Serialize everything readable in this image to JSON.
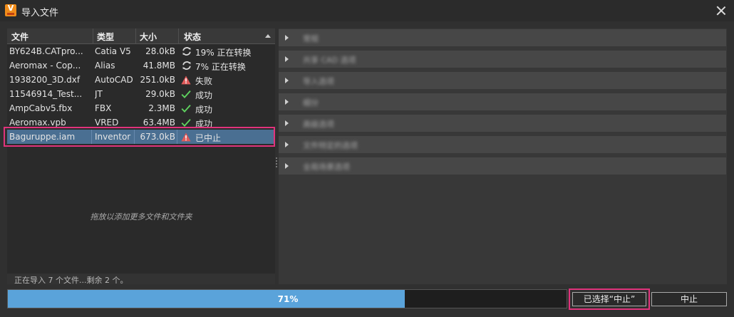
{
  "window": {
    "title": "导入文件"
  },
  "table": {
    "columns": {
      "file": "文件",
      "type": "类型",
      "size": "大小",
      "status": "状态"
    },
    "rows": [
      {
        "file": "BY624B.CATpro...",
        "type": "Catia V5",
        "size": "28.0kB",
        "status_icon": "refresh-icon",
        "status": "19% 正在转换"
      },
      {
        "file": "Aeromax - Cop...",
        "type": "Alias",
        "size": "41.8MB",
        "status_icon": "refresh-icon",
        "status": "7% 正在转换"
      },
      {
        "file": "1938200_3D.dxf",
        "type": "AutoCAD",
        "size": "251.0kB",
        "status_icon": "warning-icon",
        "status": "失败"
      },
      {
        "file": "11546914_Test...",
        "type": "JT",
        "size": "29.0kB",
        "status_icon": "check-icon",
        "status": "成功"
      },
      {
        "file": "AmpCabv5.fbx",
        "type": "FBX",
        "size": "2.3MB",
        "status_icon": "check-icon",
        "status": "成功"
      },
      {
        "file": "Aeromax.vpb",
        "type": "VRED",
        "size": "63.4MB",
        "status_icon": "check-icon",
        "status": "成功"
      },
      {
        "file": "Baguruppe.iam",
        "type": "Inventor",
        "size": "673.0kB",
        "status_icon": "warning-icon",
        "status": "已中止",
        "selected": true
      }
    ],
    "drop_hint": "拖放以添加更多文件和文件夹",
    "status_line": "正在导入 7 个文件...剩余 2 个。"
  },
  "options": {
    "sections": [
      {
        "label": "常规"
      },
      {
        "label": "共享 CAD 选项"
      },
      {
        "label": "导入选项"
      },
      {
        "label": "细分"
      },
      {
        "label": "高级选项"
      },
      {
        "label": "文件特定的选项"
      },
      {
        "label": "全局场景选项"
      }
    ]
  },
  "progress": {
    "value": 0.71,
    "label": "71%"
  },
  "buttons": {
    "abort_selected": "已选择“中止”",
    "abort": "中止"
  },
  "colors": {
    "accent": "#5aa3da",
    "selection": "#4a6f92",
    "highlight": "#e0337c",
    "warning": "#e05a5a",
    "success": "#5fd35f"
  }
}
